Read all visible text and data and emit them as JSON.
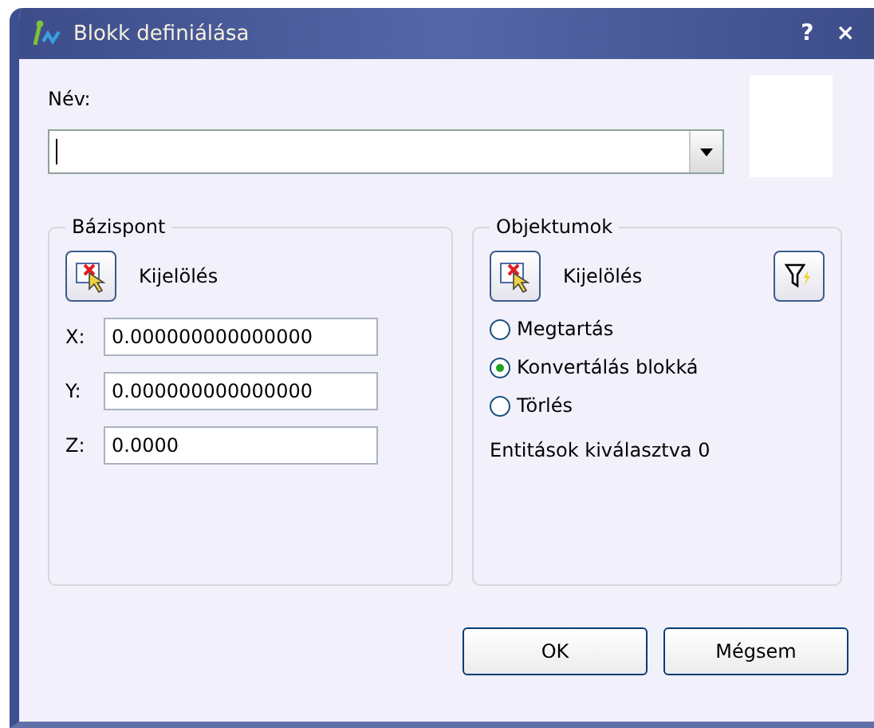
{
  "window": {
    "title": "Blokk definiálása",
    "help": "?",
    "close": "×"
  },
  "name": {
    "label": "Név:"
  },
  "base_point": {
    "title": "Bázispont",
    "pick_label": "Kijelölés",
    "coords": [
      {
        "label": "X:",
        "value": "0.000000000000000"
      },
      {
        "label": "Y:",
        "value": "0.000000000000000"
      },
      {
        "label": "Z:",
        "value": "0.0000"
      }
    ]
  },
  "objects": {
    "title": "Objektumok",
    "select_label": "Kijelölés",
    "options": [
      {
        "label": "Megtartás",
        "selected": false
      },
      {
        "label": "Konvertálás blokká",
        "selected": true
      },
      {
        "label": "Törlés",
        "selected": false
      }
    ],
    "status": "Entitások kiválasztva 0"
  },
  "buttons": [
    "OK",
    "Mégsem"
  ]
}
